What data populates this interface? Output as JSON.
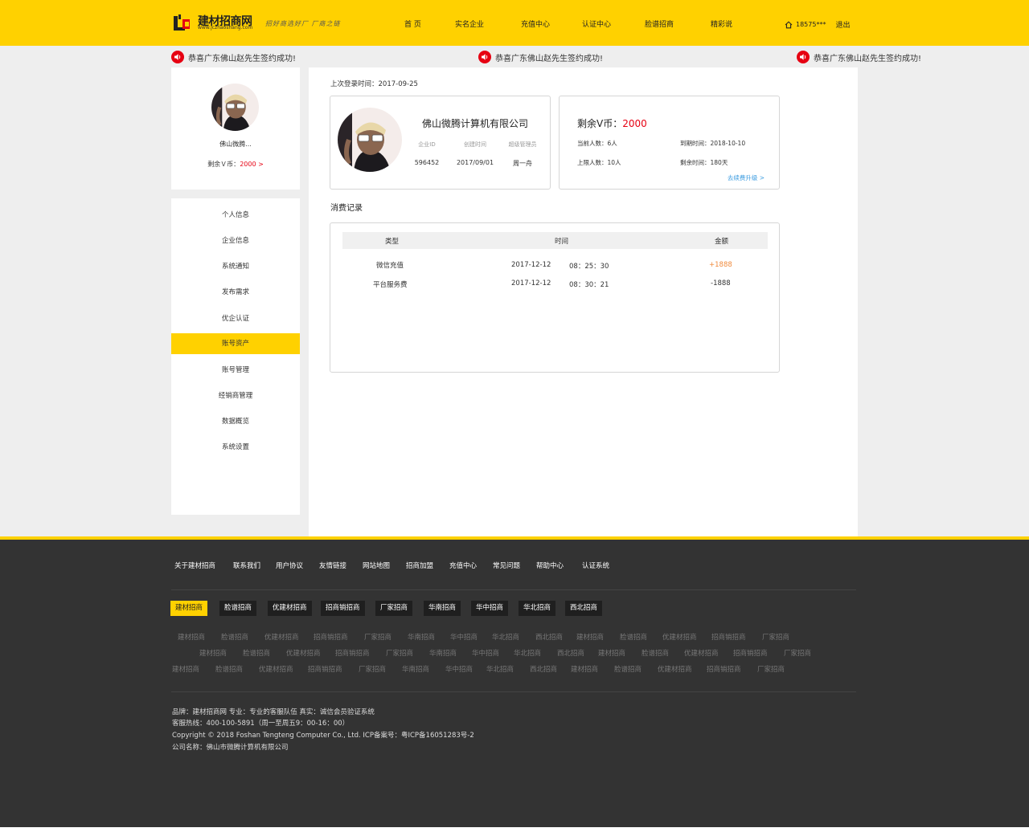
{
  "header": {
    "logo_name": "建材招商网",
    "logo_url": "www.jczhaoshang.com",
    "slogan": "招好商选好厂  厂商之链",
    "nav": [
      "首 页",
      "实名企业",
      "充值中心",
      "认证中心",
      "脸谱招商",
      "精彩说"
    ],
    "user": "18575***",
    "logout": "退出"
  },
  "ticker": [
    "恭喜广东佛山赵先生签约成功!",
    "恭喜广东佛山赵先生签约成功!",
    "恭喜广东佛山赵先生签约成功!"
  ],
  "profile": {
    "name": "佛山微腾...",
    "coins_label": "剩余Ｖ币：",
    "coins_value": "2000 >"
  },
  "menu": {
    "items": [
      "个人信息",
      "企业信息",
      "系统通知",
      "发布需求",
      "优企认证",
      "账号资产",
      "账号管理",
      "经销商管理",
      "数据概览",
      "系统设置"
    ],
    "active_index": 5
  },
  "main": {
    "last_login": "上次登录时间：2017-09-25",
    "company": {
      "name": "佛山微腾计算机有限公司",
      "cols": [
        {
          "label": "企业ID",
          "value": "596452"
        },
        {
          "label": "创建时间",
          "value": "2017/09/01"
        },
        {
          "label": "超级管理员",
          "value": "周一舟"
        }
      ]
    },
    "coins": {
      "label": "剩余V币：",
      "value": "2000",
      "current_people": "当前人数：6人",
      "expire": "到期时间：2018-10-10",
      "limit": "上限人数：10人",
      "remaining_days": "剩余时间：180天",
      "upgrade": "去续费升级 >"
    },
    "records": {
      "title": "消费记录",
      "headers": [
        "类型",
        "时间",
        "金额"
      ],
      "rows": [
        {
          "type": "微信充值",
          "date": "2017-12-12",
          "time": "08：25：30",
          "amount": "+1888"
        },
        {
          "type": "平台服务费",
          "date": "2017-12-12",
          "time": "08：30：21",
          "amount": "-1888"
        }
      ]
    }
  },
  "footer": {
    "links": [
      "关于建材招商",
      "联系我们",
      "用户协议",
      "友情链接",
      "网站地图",
      "招商加盟",
      "充值中心",
      "常见问题",
      "帮助中心",
      "认证系统"
    ],
    "tags": [
      "建材招商",
      "脸谱招商",
      "优建材招商",
      "招商销招商",
      "厂家招商",
      "华南招商",
      "华中招商",
      "华北招商",
      "西北招商"
    ],
    "keywords": [
      [
        "建材招商",
        "脸谱招商",
        "优建材招商",
        "招商销招商",
        "厂家招商",
        "华南招商",
        "华中招商",
        "华北招商",
        "西北招商",
        "建材招商",
        "脸谱招商",
        "优建材招商",
        "招商销招商",
        "厂家招商"
      ],
      [
        "建材招商",
        "脸谱招商",
        "优建材招商",
        "招商销招商",
        "厂家招商",
        "华南招商",
        "华中招商",
        "华北招商",
        "西北招商",
        "建材招商",
        "脸谱招商",
        "优建材招商",
        "招商销招商",
        "厂家招商"
      ],
      [
        "建材招商",
        "脸谱招商",
        "优建材招商",
        "招商销招商",
        "厂家招商",
        "华南招商",
        "华中招商",
        "华北招商",
        "西北招商",
        "建材招商",
        "脸谱招商",
        "优建材招商",
        "招商销招商",
        "厂家招商"
      ]
    ],
    "info": [
      "品牌：建材招商网    专业：专业的客服队伍    真实：诚信会员验证系统",
      "客服热线：400-100-5891（周一至周五9：00-16：00）",
      "Copyright © 2018 Foshan Tengteng Computer Co., Ltd.  ICP备案号：粤ICP备16051283号-2",
      "公司名称：佛山市微腾计算机有限公司"
    ]
  },
  "colors": {
    "accent": "#ffd100",
    "red": "#e60012",
    "orange": "#f08a3c",
    "link": "#3a9be0",
    "footer_bg": "#333333"
  },
  "icons": [
    "logo-mark-icon",
    "home-icon",
    "speaker-icon"
  ]
}
